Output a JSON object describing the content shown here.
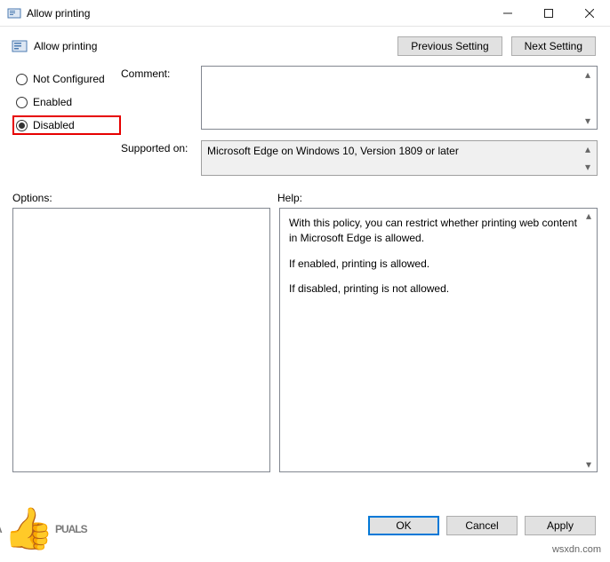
{
  "titlebar": {
    "title": "Allow printing"
  },
  "header": {
    "policy_title": "Allow printing"
  },
  "nav": {
    "prev": "Previous Setting",
    "next": "Next Setting"
  },
  "states": {
    "not_configured": "Not Configured",
    "enabled": "Enabled",
    "disabled": "Disabled",
    "selected": "disabled"
  },
  "fields": {
    "comment_label": "Comment:",
    "comment_value": "",
    "supported_label": "Supported on:",
    "supported_value": "Microsoft Edge on Windows 10, Version 1809 or later"
  },
  "sections": {
    "options_label": "Options:",
    "help_label": "Help:"
  },
  "help": {
    "p1": "With this policy, you can restrict whether printing web content in Microsoft Edge is allowed.",
    "p2": "If enabled, printing is allowed.",
    "p3": "If disabled, printing is not allowed."
  },
  "buttons": {
    "ok": "OK",
    "cancel": "Cancel",
    "apply": "Apply"
  },
  "watermark": {
    "left_pre": "A",
    "left_post": "PUALS",
    "right": "wsxdn.com"
  }
}
